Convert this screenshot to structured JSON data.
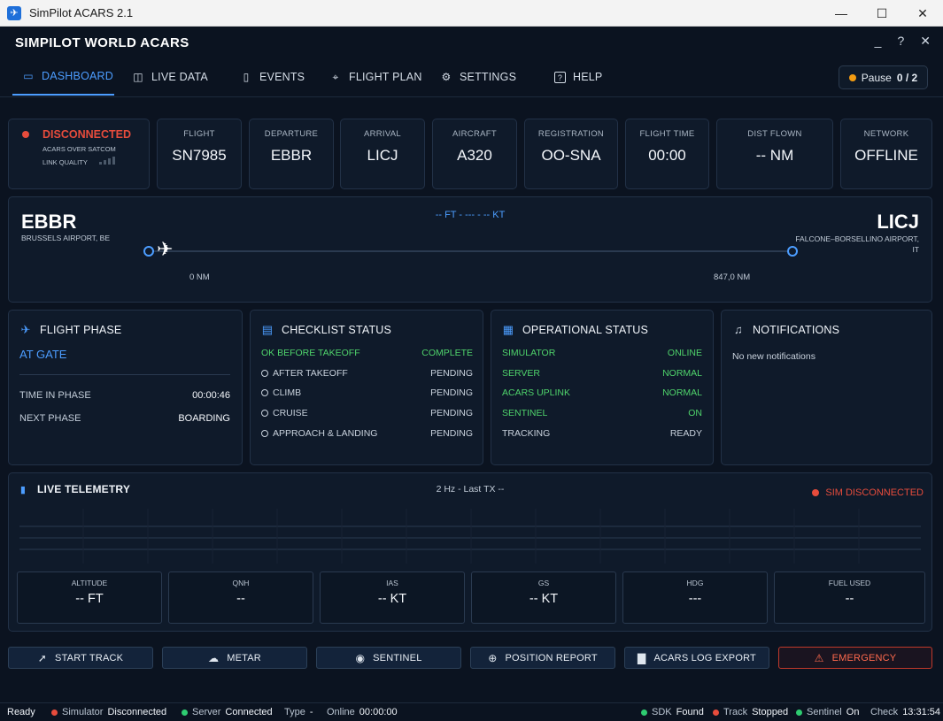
{
  "window": {
    "title": "SimPilot ACARS 2.1",
    "minimize": "—",
    "maximize": "☐",
    "close": "✕"
  },
  "app": {
    "title": "SIMPILOT WORLD ACARS",
    "minimize": "_",
    "help": "?",
    "close": "✕"
  },
  "nav": {
    "tabs": [
      {
        "label": "DASHBOARD",
        "icon": "monitor-icon"
      },
      {
        "label": "LIVE DATA",
        "icon": "chart-icon"
      },
      {
        "label": "EVENTS",
        "icon": "document-icon"
      },
      {
        "label": "FLIGHT PLAN",
        "icon": "route-icon"
      },
      {
        "label": "SETTINGS",
        "icon": "gear-icon"
      },
      {
        "label": "HELP",
        "icon": "question-icon"
      }
    ],
    "pause": {
      "label": "Pause",
      "count": "0 / 2",
      "color": "#f39c12"
    }
  },
  "connection": {
    "status": "DISCONNECTED",
    "subtitle": "ACARS OVER SATCOM",
    "quality_label": "LINK QUALITY",
    "signal_bars": 0,
    "color": "#e74c3c"
  },
  "stats": [
    {
      "label": "FLIGHT",
      "value": "SN7985"
    },
    {
      "label": "DEPARTURE",
      "value": "EBBR"
    },
    {
      "label": "ARRIVAL",
      "value": "LICJ"
    },
    {
      "label": "AIRCRAFT",
      "value": "A320"
    },
    {
      "label": "REGISTRATION",
      "value": "OO-SNA"
    },
    {
      "label": "FLIGHT TIME",
      "value": "00:00"
    },
    {
      "label": "DIST FLOWN",
      "value": "-- NM"
    },
    {
      "label": "NETWORK",
      "value": "OFFLINE"
    }
  ],
  "route": {
    "departure": {
      "code": "EBBR",
      "name": "BRUSSELS AIRPORT, BE"
    },
    "arrival": {
      "code": "LICJ",
      "name": "FALCONE–BORSELLINO AIRPORT, IT"
    },
    "telemetry": "-- FT - --- - -- KT",
    "start_distance": "0 NM",
    "end_distance": "847,0 NM",
    "progress": 0
  },
  "flight_phase": {
    "title": "FLIGHT PHASE",
    "current": "AT GATE",
    "rows": [
      {
        "label": "TIME IN PHASE",
        "value": "00:00:46"
      },
      {
        "label": "NEXT PHASE",
        "value": "BOARDING"
      }
    ]
  },
  "checklist": {
    "title": "CHECKLIST STATUS",
    "items": [
      {
        "label": "OK BEFORE TAKEOFF",
        "status": "COMPLETE",
        "done": true
      },
      {
        "label": "AFTER TAKEOFF",
        "status": "PENDING",
        "done": false
      },
      {
        "label": "CLIMB",
        "status": "PENDING",
        "done": false
      },
      {
        "label": "CRUISE",
        "status": "PENDING",
        "done": false
      },
      {
        "label": "APPROACH & LANDING",
        "status": "PENDING",
        "done": false
      }
    ]
  },
  "operational": {
    "title": "OPERATIONAL STATUS",
    "items": [
      {
        "label": "SIMULATOR",
        "status": "ONLINE",
        "ok": true
      },
      {
        "label": "SERVER",
        "status": "NORMAL",
        "ok": true
      },
      {
        "label": "ACARS UPLINK",
        "status": "NORMAL",
        "ok": true
      },
      {
        "label": "SENTINEL",
        "status": "ON",
        "ok": true
      },
      {
        "label": "TRACKING",
        "status": "READY",
        "ok": false
      }
    ]
  },
  "notifications": {
    "title": "NOTIFICATIONS",
    "empty": "No new notifications"
  },
  "telemetry": {
    "title": "LIVE TELEMETRY",
    "rate": "2 Hz  -  Last TX --",
    "sim_status": "SIM DISCONNECTED",
    "boxes": [
      {
        "label": "ALTITUDE",
        "value": "-- FT"
      },
      {
        "label": "QNH",
        "value": "--"
      },
      {
        "label": "IAS",
        "value": "-- KT"
      },
      {
        "label": "GS",
        "value": "-- KT"
      },
      {
        "label": "HDG",
        "value": "---"
      },
      {
        "label": "FUEL USED",
        "value": "--"
      }
    ]
  },
  "actions": [
    {
      "label": "START TRACK",
      "icon": "cursor-icon"
    },
    {
      "label": "METAR",
      "icon": "cloud-icon"
    },
    {
      "label": "SENTINEL",
      "icon": "eye-icon"
    },
    {
      "label": "POSITION REPORT",
      "icon": "target-icon"
    },
    {
      "label": "ACARS LOG EXPORT",
      "icon": "file-icon"
    },
    {
      "label": "EMERGENCY",
      "icon": "warning-icon"
    }
  ],
  "statusbar": {
    "ready": "Ready",
    "simulator": {
      "label": "Simulator",
      "value": "Disconnected",
      "color": "#e74c3c"
    },
    "server": {
      "label": "Server",
      "value": "Connected",
      "color": "#2ecc71"
    },
    "type": {
      "label": "Type",
      "value": "-"
    },
    "online": {
      "label": "Online",
      "value": "00:00:00"
    },
    "sdk": {
      "label": "SDK",
      "value": "Found",
      "color": "#2ecc71"
    },
    "track": {
      "label": "Track",
      "value": "Stopped",
      "color": "#e74c3c"
    },
    "sentinel": {
      "label": "Sentinel",
      "value": "On",
      "color": "#2ecc71"
    },
    "check": {
      "label": "Check",
      "value": "13:31:54"
    }
  }
}
